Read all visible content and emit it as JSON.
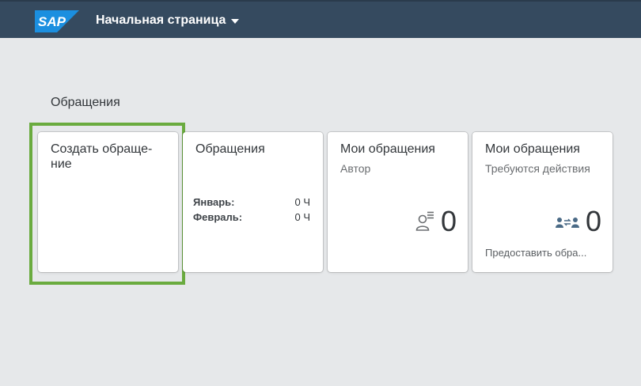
{
  "shell": {
    "logo_text": "SAP",
    "title": "Начальная страница",
    "colors": {
      "bar": "#354a5f",
      "logo": "#1b8fe0",
      "focus": "#6aab3f"
    }
  },
  "group": {
    "title": "Обращения"
  },
  "tiles": [
    {
      "title": "Создать обраще-ние",
      "focused": true
    },
    {
      "title": "Обращения",
      "rows": [
        {
          "label": "Январь:",
          "value": "0 Ч"
        },
        {
          "label": "Февраль:",
          "value": "0 Ч"
        }
      ]
    },
    {
      "title": "Мои обращения",
      "subtitle": "Автор",
      "icon": "person-list-icon",
      "value": "0"
    },
    {
      "title": "Мои обращения",
      "subtitle": "Требуются действия",
      "icon": "people-exchange-icon",
      "value": "0",
      "footer": "Предоставить обра..."
    }
  ]
}
